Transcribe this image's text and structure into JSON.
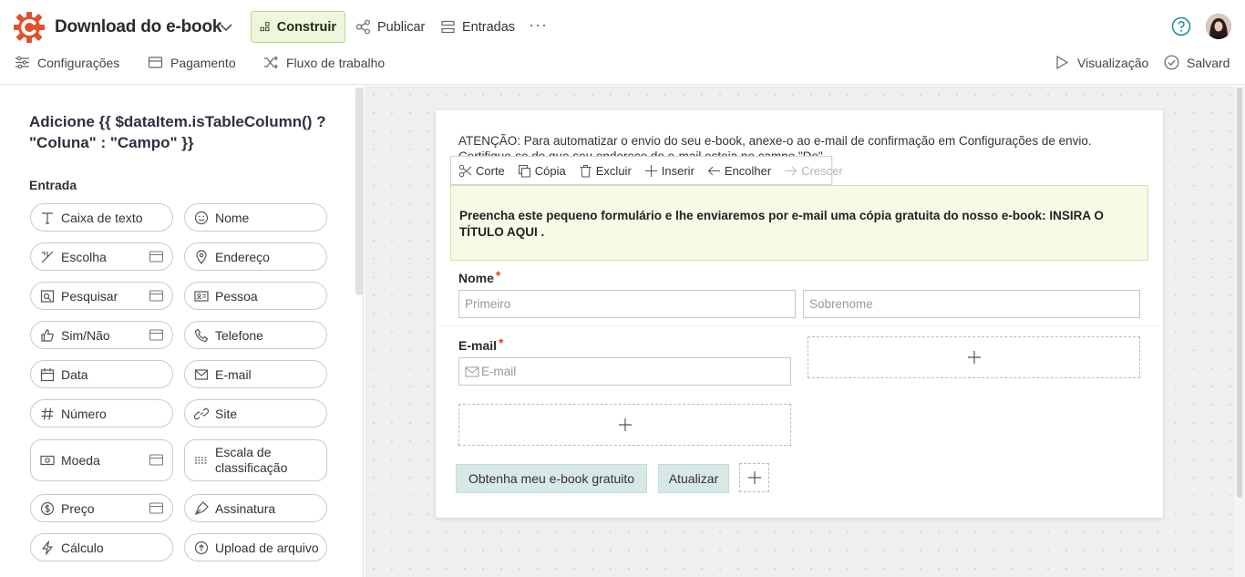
{
  "header": {
    "title": "Download do e-book",
    "nav": {
      "build": "Construir",
      "publish": "Publicar",
      "entries": "Entradas",
      "more": "···"
    },
    "sub": {
      "settings": "Configurações",
      "payment": "Pagamento",
      "workflow": "Fluxo de trabalho",
      "preview": "Visualização",
      "saved": "Salvard"
    },
    "accent": "#e0522b"
  },
  "sidebar": {
    "title": "Adicione {{ $dataItem.isTableColumn() ? \"Coluna\" : \"Campo\" }}",
    "section": "Entrada",
    "fields": {
      "textbox": "Caixa de texto",
      "name": "Nome",
      "choice": "Escolha",
      "address": "Endereço",
      "lookup": "Pesquisar",
      "person": "Pessoa",
      "yesno": "Sim/Não",
      "phone": "Telefone",
      "date": "Data",
      "email": "E-mail",
      "number": "Número",
      "website": "Site",
      "currency": "Moeda",
      "rating": "Escala de classificação",
      "price": "Preço",
      "signature": "Assinatura",
      "calc": "Cálculo",
      "upload": "Upload de arquivo"
    }
  },
  "form": {
    "attention": "ATENÇÃO: Para automatizar o envio do seu e-book, anexe-o ao e-mail de confirmação em Configurações de envio. Certifique-se de que seu endereço de e-mail esteja no campo \"De\".",
    "toolbar": {
      "cut": "Corte",
      "copy": "Cópia",
      "delete": "Excluir",
      "insert": "Inserir",
      "shrink": "Encolher",
      "grow": "Crescer"
    },
    "banner": "Preencha este pequeno formulário e lhe enviaremos por e-mail uma cópia gratuita do nosso e-book: INSIRA O TÍTULO AQUI .",
    "name_label": "Nome",
    "required_mark": "*",
    "first_placeholder": "Primeiro",
    "last_placeholder": "Sobrenome",
    "email_label": "E-mail",
    "email_placeholder": "E-mail",
    "submit": "Obtenha meu e-book gratuito",
    "update": "Atualizar"
  }
}
